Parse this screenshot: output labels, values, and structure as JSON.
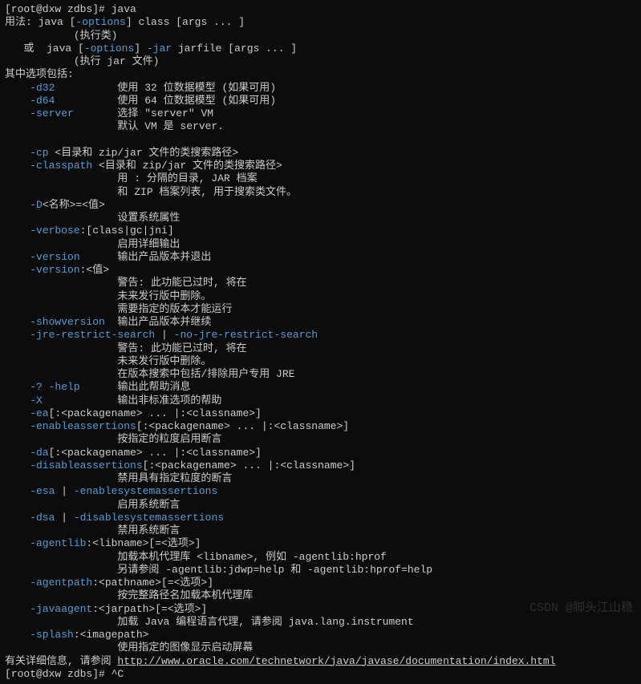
{
  "l00": "[root@dxw zdbs]# java",
  "l01a": "用法: java [",
  "l01b": "-options",
  "l01c": "] class [args ... ]",
  "l02": "           (执行类)",
  "l03a": "   或  java [",
  "l03b": "-options",
  "l03c": "] ",
  "l03d": "-jar",
  "l03e": " jarfile [args ... ]",
  "l04": "           (执行 jar 文件)",
  "l05": "其中选项包括:",
  "l06a": "    -d32",
  "l06b": "          使用 32 位数据模型 (如果可用)",
  "l07a": "    -d64",
  "l07b": "          使用 64 位数据模型 (如果可用)",
  "l08a": "    -server",
  "l08b": "       选择 \"server\" VM",
  "l09": "                  默认 VM 是 server.",
  "l10": " ",
  "l11a": "    -cp",
  "l11b": " <目录和 zip/jar 文件的类搜索路径>",
  "l12a": "    -classpath",
  "l12b": " <目录和 zip/jar 文件的类搜索路径>",
  "l13": "                  用 : 分隔的目录, JAR 档案",
  "l14": "                  和 ZIP 档案列表, 用于搜索类文件。",
  "l15a": "    -D",
  "l15b": "<名称>=<值>",
  "l16": "                  设置系统属性",
  "l17a": "    -verbose",
  "l17b": ":[class|gc|jni]",
  "l18": "                  启用详细输出",
  "l19a": "    -version",
  "l19b": "      输出产品版本并退出",
  "l20a": "    -version",
  "l20b": ":<值>",
  "l21": "                  警告: 此功能已过时, 将在",
  "l22": "                  未来发行版中删除。",
  "l23": "                  需要指定的版本才能运行",
  "l24a": "    -showversion",
  "l24b": "  输出产品版本并继续",
  "l25a": "    -jre-restrict-search",
  "l25b": " | ",
  "l25c": "-no-jre-restrict-search",
  "l26": "                  警告: 此功能已过时, 将在",
  "l27": "                  未来发行版中删除。",
  "l28": "                  在版本搜索中包括/排除用户专用 JRE",
  "l29a": "    -?",
  "l29b": " ",
  "l29c": "-help",
  "l29d": "      输出此帮助消息",
  "l30a": "    -X",
  "l30b": "            输出非标准选项的帮助",
  "l31a": "    -ea",
  "l31b": "[:<packagename> ... |:<classname>]",
  "l32a": "    -enableassertions",
  "l32b": "[:<packagename> ... |:<classname>]",
  "l33": "                  按指定的粒度启用断言",
  "l34a": "    -da",
  "l34b": "[:<packagename> ... |:<classname>]",
  "l35a": "    -disableassertions",
  "l35b": "[:<packagename> ... |:<classname>]",
  "l36": "                  禁用具有指定粒度的断言",
  "l37a": "    -esa",
  "l37b": " | ",
  "l37c": "-enablesystemassertions",
  "l38": "                  启用系统断言",
  "l39a": "    -dsa",
  "l39b": " | ",
  "l39c": "-disablesystemassertions",
  "l40": "                  禁用系统断言",
  "l41a": "    -agentlib",
  "l41b": ":<libname>[=<选项>]",
  "l42": "                  加载本机代理库 <libname>, 例如 -agentlib:hprof",
  "l43": "                  另请参阅 -agentlib:jdwp=help 和 -agentlib:hprof=help",
  "l44a": "    -agentpath",
  "l44b": ":<pathname>[=<选项>]",
  "l45": "                  按完整路径名加载本机代理库",
  "l46a": "    -javaagent",
  "l46b": ":<jarpath>[=<选项>]",
  "l47": "                  加载 Java 编程语言代理, 请参阅 java.lang.instrument",
  "l48a": "    -splash",
  "l48b": ":<imagepath>",
  "l49": "                  使用指定的图像显示启动屏幕",
  "l50a": "有关详细信息, 请参阅 ",
  "l50b": "http://www.oracle.com/technetwork/java/javase/documentation/index.html",
  "l51": "[root@dxw zdbs]# ^C",
  "watermark": "CSDN @脚头江山稳"
}
